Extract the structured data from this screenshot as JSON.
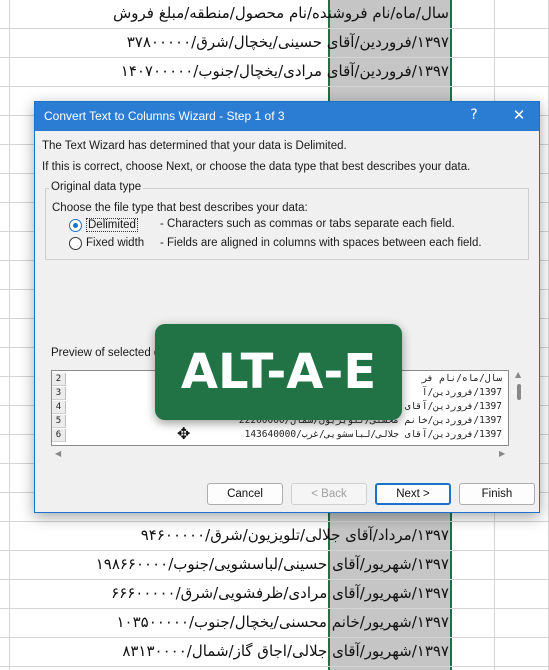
{
  "sheet": {
    "rows": [
      "سال/ماه/نام فروشنده/نام محصول/منطقه/مبلغ فروش",
      "۱۳۹۷/فروردین/آقای حسینی/یخچال/شرق/۳۷۸۰۰۰۰۰",
      "۱۳۹۷/فروردین/آقای مرادی/یخچال/جنوب/۱۴۰۷۰۰۰۰۰",
      "",
      "",
      "",
      "",
      "",
      "",
      "",
      "",
      "",
      "",
      "",
      "",
      "",
      "",
      "",
      "۱۳۹۷/مرداد/آقای جلالی/تلویزیون/شرق/۹۴۶۰۰۰۰۰",
      "۱۳۹۷/شهریور/آقای حسینی/لباسشویی/جنوب/۱۹۸۶۶۰۰۰۰",
      "۱۳۹۷/شهریور/آقای مرادی/ظرفشویی/شرق/۶۶۶۰۰۰۰۰",
      "۱۳۹۷/شهریور/خانم محسنی/یخچال/جنوب/۱۰۳۵۰۰۰۰۰",
      "۱۳۹۷/شهریور/آقای جلالی/اجاق گاز/شمال/۸۳۱۳۰۰۰۰"
    ]
  },
  "dialog": {
    "title": "Convert Text to Columns Wizard - Step 1 of 3",
    "help": "?",
    "close": "✕",
    "intro1": "The Text Wizard has determined that your data is Delimited.",
    "intro2": "If this is correct, choose Next, or choose the data type that best describes your data.",
    "group_label": "Original data type",
    "choose_label": "Choose the file type that best describes your data:",
    "delimited_label": "Delimited",
    "delimited_desc": "- Characters such as commas or tabs separate each field.",
    "fixed_label": "Fixed width",
    "fixed_desc": "- Fields are aligned in columns with spaces between each field.",
    "preview_label": "Preview of selected d",
    "preview_rows": [
      {
        "num": "2",
        "text": "سال/ماه/نام فر"
      },
      {
        "num": "3",
        "text": "1397/فروردین/آ"
      },
      {
        "num": "4",
        "text": "1397/فروردین/آقای"
      },
      {
        "num": "5",
        "text": "1397/فروردین/خانم محسنی/تلویزیون/شمال/22260000"
      },
      {
        "num": "6",
        "text": "1397/فروردین/آقای جلالی/لباسشویی/غرب/143640000"
      }
    ],
    "buttons": {
      "cancel": "Cancel",
      "back": "< Back",
      "next": "Next >",
      "finish": "Finish"
    }
  },
  "overlay": {
    "shortcut": "ALT-A-E"
  },
  "colors": {
    "excel_green": "#217346",
    "title_blue": "#2b7cd3"
  }
}
